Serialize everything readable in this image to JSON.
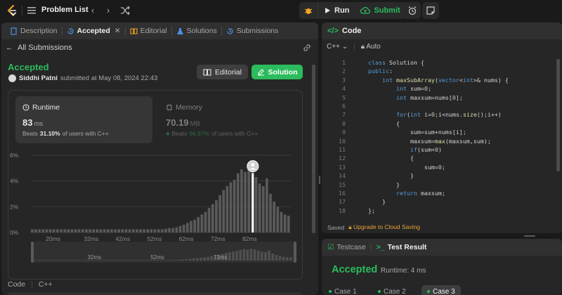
{
  "topbar": {
    "title": "Problem List",
    "run_label": "Run",
    "submit_label": "Submit"
  },
  "left_tabs": [
    {
      "label": "Description"
    },
    {
      "label": "Accepted"
    },
    {
      "label": "Editorial"
    },
    {
      "label": "Solutions"
    },
    {
      "label": "Submissions"
    }
  ],
  "submission": {
    "back_label": "All Submissions",
    "status": "Accepted",
    "user": "Siddhi Patni",
    "submitted_text": "submitted at May 08, 2024 22:43",
    "editorial_btn": "Editorial",
    "solution_btn": "Solution"
  },
  "runtime": {
    "label": "Runtime",
    "value": "83",
    "unit": "ms",
    "beats_prefix": "Beats",
    "beats_pct": "31.10%",
    "beats_suffix": "of users with C++"
  },
  "memory": {
    "label": "Memory",
    "value": "70.19",
    "unit": "MB",
    "beats_prefix": "Beats",
    "beats_pct": "66.97%",
    "beats_suffix": "of users with C++"
  },
  "chart_data": {
    "type": "bar",
    "title": "",
    "xlabel": "",
    "ylabel": "",
    "yticks": [
      "6%",
      "4%",
      "2%",
      "0%"
    ],
    "ylim": [
      0,
      6
    ],
    "xticks": [
      "20ms",
      "32ms",
      "42ms",
      "52ms",
      "62ms",
      "72ms",
      "82ms"
    ],
    "x_range_ms": [
      13,
      95
    ],
    "highlight_ms": 83,
    "values": [
      0.25,
      0.25,
      0.25,
      0.25,
      0.25,
      0.25,
      0.25,
      0.25,
      0.25,
      0.25,
      0.25,
      0.25,
      0.25,
      0.25,
      0.25,
      0.25,
      0.25,
      0.25,
      0.25,
      0.25,
      0.25,
      0.25,
      0.25,
      0.25,
      0.25,
      0.25,
      0.25,
      0.25,
      0.25,
      0.25,
      0.25,
      0.25,
      0.25,
      0.25,
      0.25,
      0.25,
      0.25,
      0.3,
      0.35,
      0.35,
      0.4,
      0.5,
      0.6,
      0.75,
      0.9,
      1.0,
      1.2,
      1.4,
      1.6,
      1.9,
      2.2,
      2.5,
      2.9,
      3.3,
      3.6,
      3.9,
      4.1,
      4.6,
      4.9,
      4.7,
      5.0,
      4.8,
      4.3,
      3.8,
      3.6,
      4.2,
      3.0,
      2.4,
      2.0,
      1.6,
      1.4,
      1.3
    ],
    "mini_xticks": [
      "32ms",
      "52ms",
      "72ms"
    ]
  },
  "bottom_left": {
    "code_label": "Code",
    "lang": "C++"
  },
  "editor": {
    "header": "Code",
    "lang": "C++",
    "mode": "Auto",
    "saved": "Saved",
    "upgrade": "Upgrade to Cloud Saving",
    "lines": [
      {
        "n": "1",
        "code": "class Solution {"
      },
      {
        "n": "2",
        "code": "public:"
      },
      {
        "n": "3",
        "code": "    int maxSubArray(vector<int>& nums) {"
      },
      {
        "n": "4",
        "code": "        int sum=0;"
      },
      {
        "n": "5",
        "code": "        int maxsum=nums[0];"
      },
      {
        "n": "6",
        "code": ""
      },
      {
        "n": "7",
        "code": "        for(int i=0;i<nums.size();i++)"
      },
      {
        "n": "8",
        "code": "        {"
      },
      {
        "n": "9",
        "code": "            sum=sum+nums[i];"
      },
      {
        "n": "10",
        "code": "            maxsum=max(maxsum,sum);"
      },
      {
        "n": "11",
        "code": "            if(sum<0)"
      },
      {
        "n": "12",
        "code": "            {"
      },
      {
        "n": "13",
        "code": "                sum=0;"
      },
      {
        "n": "14",
        "code": "            }"
      },
      {
        "n": "15",
        "code": "        }"
      },
      {
        "n": "16",
        "code": "        return maxsum;"
      },
      {
        "n": "17",
        "code": "    }"
      },
      {
        "n": "18",
        "code": "};"
      }
    ]
  },
  "testpanel": {
    "testcase_tab": "Testcase",
    "result_tab": "Test Result",
    "status": "Accepted",
    "runtime_text": "Runtime: 4 ms",
    "cases": [
      "Case 1",
      "Case 2",
      "Case 3"
    ]
  }
}
